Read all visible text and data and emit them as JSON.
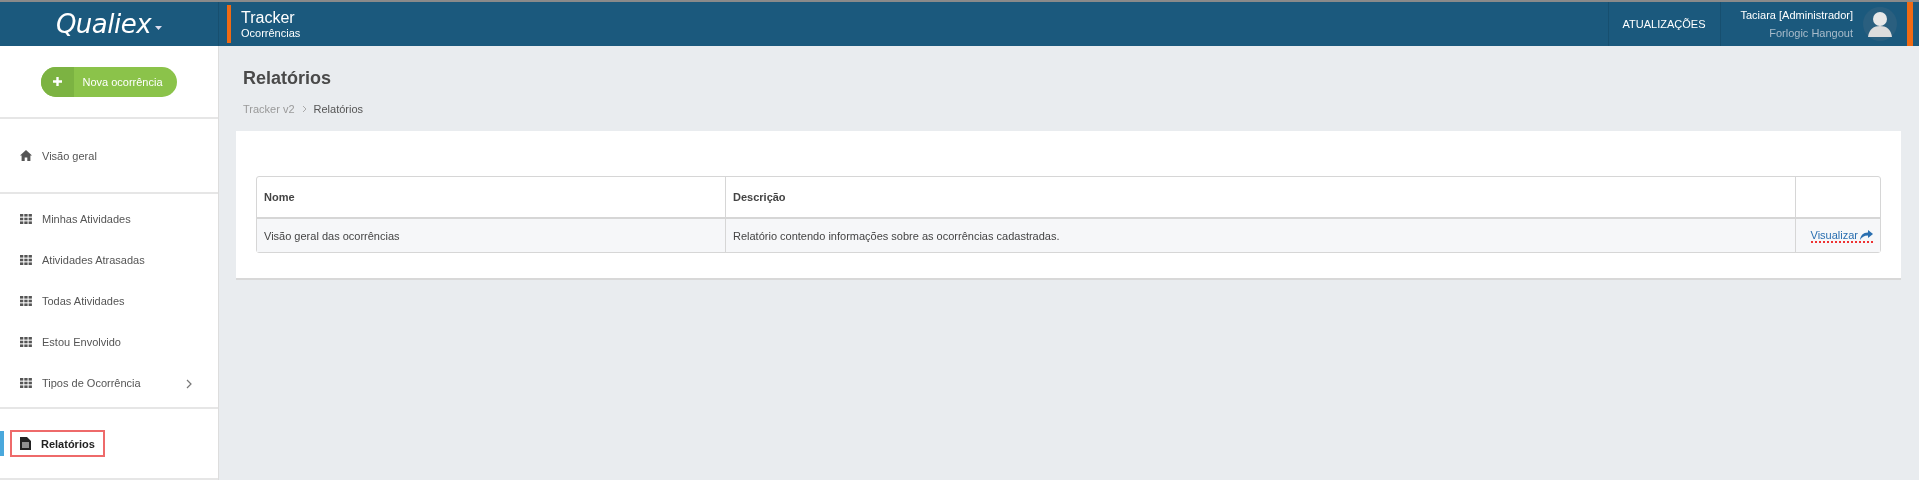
{
  "header": {
    "logo": "Qualiex",
    "app_title": "Tracker",
    "app_subtitle": "Ocorrências",
    "updates_link": "ATUALIZAÇÕES",
    "user_name": "Taciara [Administrador]",
    "user_subtitle": "Forlogic Hangout"
  },
  "sidebar": {
    "new_button": "Nova ocorrência",
    "groups": [
      {
        "items": [
          {
            "label": "Visão geral",
            "kind": "home",
            "selected": false,
            "highlighted": false,
            "has_submenu": false
          }
        ]
      },
      {
        "items": [
          {
            "label": "Minhas Atividades",
            "kind": "grid",
            "selected": false,
            "highlighted": false,
            "has_submenu": false
          },
          {
            "label": "Atividades Atrasadas",
            "kind": "grid",
            "selected": false,
            "highlighted": false,
            "has_submenu": false
          },
          {
            "label": "Todas Atividades",
            "kind": "grid",
            "selected": false,
            "highlighted": false,
            "has_submenu": false
          },
          {
            "label": "Estou Envolvido",
            "kind": "grid",
            "selected": false,
            "highlighted": false,
            "has_submenu": false
          },
          {
            "label": "Tipos de Ocorrência",
            "kind": "grid",
            "selected": false,
            "highlighted": false,
            "has_submenu": true
          }
        ]
      },
      {
        "items": [
          {
            "label": "Relatórios",
            "kind": "document",
            "selected": true,
            "highlighted": true,
            "has_submenu": false
          }
        ]
      }
    ]
  },
  "page": {
    "title": "Relatórios",
    "breadcrumb": [
      "Tracker v2",
      "Relatórios"
    ]
  },
  "table": {
    "columns": [
      "Nome",
      "Descrição"
    ],
    "rows": [
      {
        "name": "Visão geral das ocorrências",
        "description": "Relatório contendo informações sobre as ocorrências cadastradas.",
        "action": "Visualizar"
      }
    ]
  }
}
